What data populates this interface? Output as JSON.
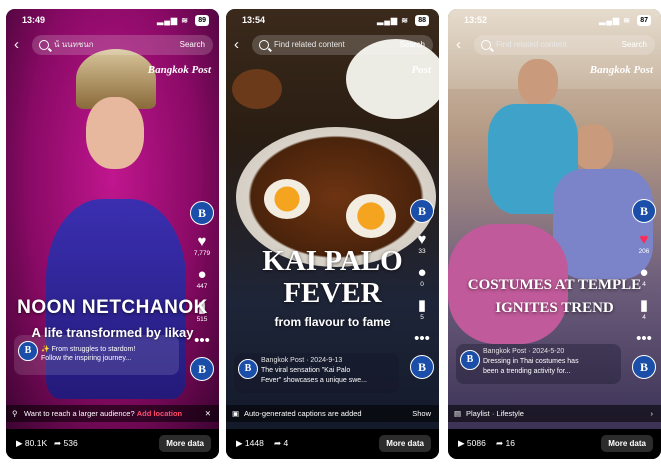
{
  "cards": [
    {
      "status": {
        "time": "13:49",
        "battery": "89"
      },
      "search": {
        "placeholder": "น้ นนทชนก",
        "button": "Search"
      },
      "brand": "Bangkok Post",
      "rail": [
        {
          "icon": "heart-icon",
          "count": "7,779"
        },
        {
          "icon": "comment-icon",
          "count": "447"
        },
        {
          "icon": "bookmark-icon",
          "count": "515"
        }
      ],
      "headline": "NOON NETCHANOK",
      "subhead": "A life transformed by likay",
      "caption": {
        "line1": "✨ From struggles to stardom!",
        "line2": "Follow the inspiring journey..."
      },
      "banner": {
        "text": "Want to reach a larger audience?",
        "link": "Add location",
        "right": "✕"
      },
      "bottom": {
        "plays": "80.1K",
        "shares": "536",
        "more": "More data"
      }
    },
    {
      "status": {
        "time": "13:54",
        "battery": "88"
      },
      "search": {
        "placeholder": "Find related content",
        "button": "Search"
      },
      "brand": "Post",
      "rail": [
        {
          "icon": "heart-icon",
          "count": "33"
        },
        {
          "icon": "comment-icon",
          "count": "0"
        },
        {
          "icon": "bookmark-icon",
          "count": "5"
        }
      ],
      "headline_line1": "KAI PALO",
      "headline_line2": "FEVER",
      "subhead": "from flavour to fame",
      "caption": {
        "header": "Bangkok Post · 2024-9-13",
        "line1": "The viral sensation \"Kai Palo",
        "line2": "Fever\" showcases a unique swe..."
      },
      "banner": {
        "text": "Auto-generated captions are added",
        "right": "Show"
      },
      "bottom": {
        "plays": "1448",
        "shares": "4",
        "more": "More data"
      }
    },
    {
      "status": {
        "time": "13:52",
        "battery": "87"
      },
      "search": {
        "placeholder": "Find related content",
        "button": "Search"
      },
      "brand": "Bangkok Post",
      "rail": [
        {
          "icon": "heart-icon",
          "count": "206"
        },
        {
          "icon": "comment-icon",
          "count": "4"
        },
        {
          "icon": "bookmark-icon",
          "count": "4"
        }
      ],
      "headline_line1": "COSTUMES AT TEMPLE",
      "headline_line2": "IGNITES TREND",
      "caption": {
        "header": "Bangkok Post · 2024-5-20",
        "line1": "Dressing in Thai costumes has",
        "line2": "been a trending activity for..."
      },
      "banner": {
        "text": "Playlist · Lifestyle",
        "right": "›"
      },
      "bottom": {
        "plays": "5086",
        "shares": "16",
        "more": "More data"
      }
    }
  ]
}
